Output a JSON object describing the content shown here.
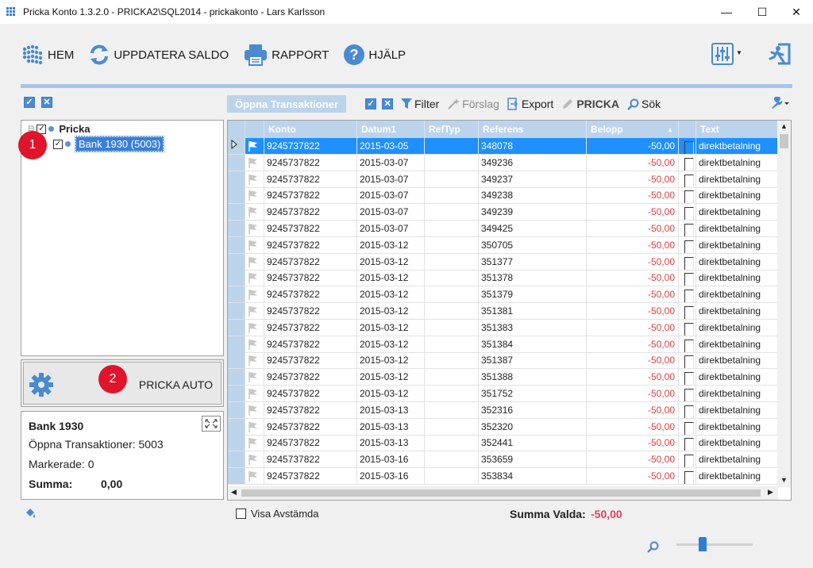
{
  "window": {
    "title": "Pricka Konto 1.3.2.0 - PRICKA2\\SQL2014 - prickakonto - Lars Karlsson",
    "minimize": "—",
    "maximize": "☐",
    "close": "✕"
  },
  "toolbar": {
    "home": "HEM",
    "update_balance": "UPPDATERA SALDO",
    "report": "RAPPORT",
    "help": "HJÄLP"
  },
  "grid_toolbar": {
    "tab": "Öppna Transaktioner",
    "filter": "Filter",
    "suggestion": "Förslag",
    "export": "Export",
    "pricka": "PRICKA",
    "search": "Sök"
  },
  "tree": {
    "root": "Pricka",
    "child": "Bank 1930 (5003)"
  },
  "badges": [
    "1",
    "2"
  ],
  "auto_button": {
    "label": "PRICKA AUTO"
  },
  "info": {
    "account": "Bank 1930",
    "open_transactions": "Öppna Transaktioner: 5003",
    "marked": "Markerade: 0",
    "sum_label": "Summa:",
    "sum_value": "0,00"
  },
  "grid": {
    "columns": [
      "Konto",
      "Datum1",
      "RefTyp",
      "Referens",
      "Belopp",
      "",
      "Text"
    ],
    "rows": [
      {
        "konto": "9245737822",
        "datum": "2015-03-05",
        "reftyp": "",
        "referens": "348078",
        "belopp": "-50,00",
        "text": "direktbetalning"
      },
      {
        "konto": "9245737822",
        "datum": "2015-03-07",
        "reftyp": "",
        "referens": "349236",
        "belopp": "-50,00",
        "text": "direktbetalning"
      },
      {
        "konto": "9245737822",
        "datum": "2015-03-07",
        "reftyp": "",
        "referens": "349237",
        "belopp": "-50,00",
        "text": "direktbetalning"
      },
      {
        "konto": "9245737822",
        "datum": "2015-03-07",
        "reftyp": "",
        "referens": "349238",
        "belopp": "-50,00",
        "text": "direktbetalning"
      },
      {
        "konto": "9245737822",
        "datum": "2015-03-07",
        "reftyp": "",
        "referens": "349239",
        "belopp": "-50,00",
        "text": "direktbetalning"
      },
      {
        "konto": "9245737822",
        "datum": "2015-03-07",
        "reftyp": "",
        "referens": "349425",
        "belopp": "-50,00",
        "text": "direktbetalning"
      },
      {
        "konto": "9245737822",
        "datum": "2015-03-12",
        "reftyp": "",
        "referens": "350705",
        "belopp": "-50,00",
        "text": "direktbetalning"
      },
      {
        "konto": "9245737822",
        "datum": "2015-03-12",
        "reftyp": "",
        "referens": "351377",
        "belopp": "-50,00",
        "text": "direktbetalning"
      },
      {
        "konto": "9245737822",
        "datum": "2015-03-12",
        "reftyp": "",
        "referens": "351378",
        "belopp": "-50,00",
        "text": "direktbetalning"
      },
      {
        "konto": "9245737822",
        "datum": "2015-03-12",
        "reftyp": "",
        "referens": "351379",
        "belopp": "-50,00",
        "text": "direktbetalning"
      },
      {
        "konto": "9245737822",
        "datum": "2015-03-12",
        "reftyp": "",
        "referens": "351381",
        "belopp": "-50,00",
        "text": "direktbetalning"
      },
      {
        "konto": "9245737822",
        "datum": "2015-03-12",
        "reftyp": "",
        "referens": "351383",
        "belopp": "-50,00",
        "text": "direktbetalning"
      },
      {
        "konto": "9245737822",
        "datum": "2015-03-12",
        "reftyp": "",
        "referens": "351384",
        "belopp": "-50,00",
        "text": "direktbetalning"
      },
      {
        "konto": "9245737822",
        "datum": "2015-03-12",
        "reftyp": "",
        "referens": "351387",
        "belopp": "-50,00",
        "text": "direktbetalning"
      },
      {
        "konto": "9245737822",
        "datum": "2015-03-12",
        "reftyp": "",
        "referens": "351388",
        "belopp": "-50,00",
        "text": "direktbetalning"
      },
      {
        "konto": "9245737822",
        "datum": "2015-03-12",
        "reftyp": "",
        "referens": "351752",
        "belopp": "-50,00",
        "text": "direktbetalning"
      },
      {
        "konto": "9245737822",
        "datum": "2015-03-13",
        "reftyp": "",
        "referens": "352316",
        "belopp": "-50,00",
        "text": "direktbetalning"
      },
      {
        "konto": "9245737822",
        "datum": "2015-03-13",
        "reftyp": "",
        "referens": "352320",
        "belopp": "-50,00",
        "text": "direktbetalning"
      },
      {
        "konto": "9245737822",
        "datum": "2015-03-13",
        "reftyp": "",
        "referens": "352441",
        "belopp": "-50,00",
        "text": "direktbetalning"
      },
      {
        "konto": "9245737822",
        "datum": "2015-03-16",
        "reftyp": "",
        "referens": "353659",
        "belopp": "-50,00",
        "text": "direktbetalning"
      },
      {
        "konto": "9245737822",
        "datum": "2015-03-16",
        "reftyp": "",
        "referens": "353834",
        "belopp": "-50,00",
        "text": "direktbetalning"
      }
    ]
  },
  "footer": {
    "show_reconciled": "Visa Avstämda",
    "sum_selected_label": "Summa Valda:",
    "sum_selected_value": "-50,00"
  },
  "colors": {
    "accent": "#4a8ad1",
    "header": "#bcd3ec",
    "selected_row": "#1e90ff",
    "negative": "#e04040",
    "badge": "#e0142a"
  }
}
